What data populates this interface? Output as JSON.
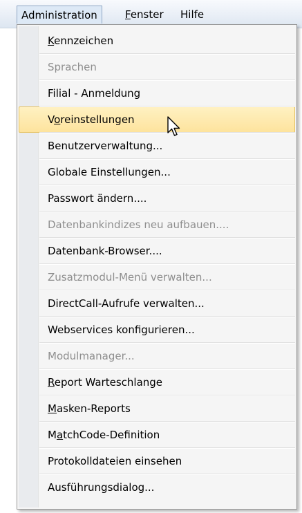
{
  "menubar": {
    "items": [
      {
        "label_pre": "",
        "label_u": "",
        "label_post": "Administration"
      },
      {
        "label_pre": "",
        "label_u": "F",
        "label_post": "enster"
      },
      {
        "label_pre": "",
        "label_u": "",
        "label_post": "Hilfe"
      }
    ]
  },
  "dropdown": {
    "items": [
      {
        "pre": "",
        "u": "K",
        "post": "ennzeichen",
        "disabled": false
      },
      {
        "pre": "",
        "u": "",
        "post": "Sprachen",
        "disabled": true
      },
      {
        "pre": "",
        "u": "",
        "post": "Filial - Anmeldung",
        "disabled": false
      },
      {
        "pre": "V",
        "u": "o",
        "post": "reinstellungen",
        "disabled": false,
        "highlighted": true
      },
      {
        "pre": "",
        "u": "",
        "post": "Benutzerverwaltung...",
        "disabled": false
      },
      {
        "pre": "",
        "u": "",
        "post": "Globale Einstellungen...",
        "disabled": false
      },
      {
        "pre": "",
        "u": "",
        "post": "Passwort ändern....",
        "disabled": false
      },
      {
        "pre": "",
        "u": "",
        "post": "Datenbankindizes neu aufbauen....",
        "disabled": true
      },
      {
        "pre": "",
        "u": "",
        "post": "Datenbank-Browser....",
        "disabled": false
      },
      {
        "pre": "",
        "u": "",
        "post": "Zusatzmodul-Menü verwalten...",
        "disabled": true
      },
      {
        "pre": "",
        "u": "",
        "post": "DirectCall-Aufrufe verwalten...",
        "disabled": false
      },
      {
        "pre": "",
        "u": "",
        "post": "Webservices konfigurieren...",
        "disabled": false
      },
      {
        "pre": "",
        "u": "",
        "post": "Modulmanager...",
        "disabled": true
      },
      {
        "pre": "",
        "u": "R",
        "post": "eport Warteschlange",
        "disabled": false
      },
      {
        "pre": "",
        "u": "M",
        "post": "asken-Reports",
        "disabled": false
      },
      {
        "pre": "M",
        "u": "a",
        "post": "tchCode-Definition",
        "disabled": false
      },
      {
        "pre": "",
        "u": "",
        "post": "Protokolldateien einsehen",
        "disabled": false
      },
      {
        "pre": "",
        "u": "",
        "post": "Ausführungsdialog...",
        "disabled": false
      }
    ]
  },
  "icons": {
    "cursor": "mouse-pointer-icon"
  },
  "colors": {
    "highlight": "#fde39d",
    "highlight_border": "#e5c365",
    "disabled_text": "#8e8e8e",
    "menubar_open": "#dde9f6"
  }
}
